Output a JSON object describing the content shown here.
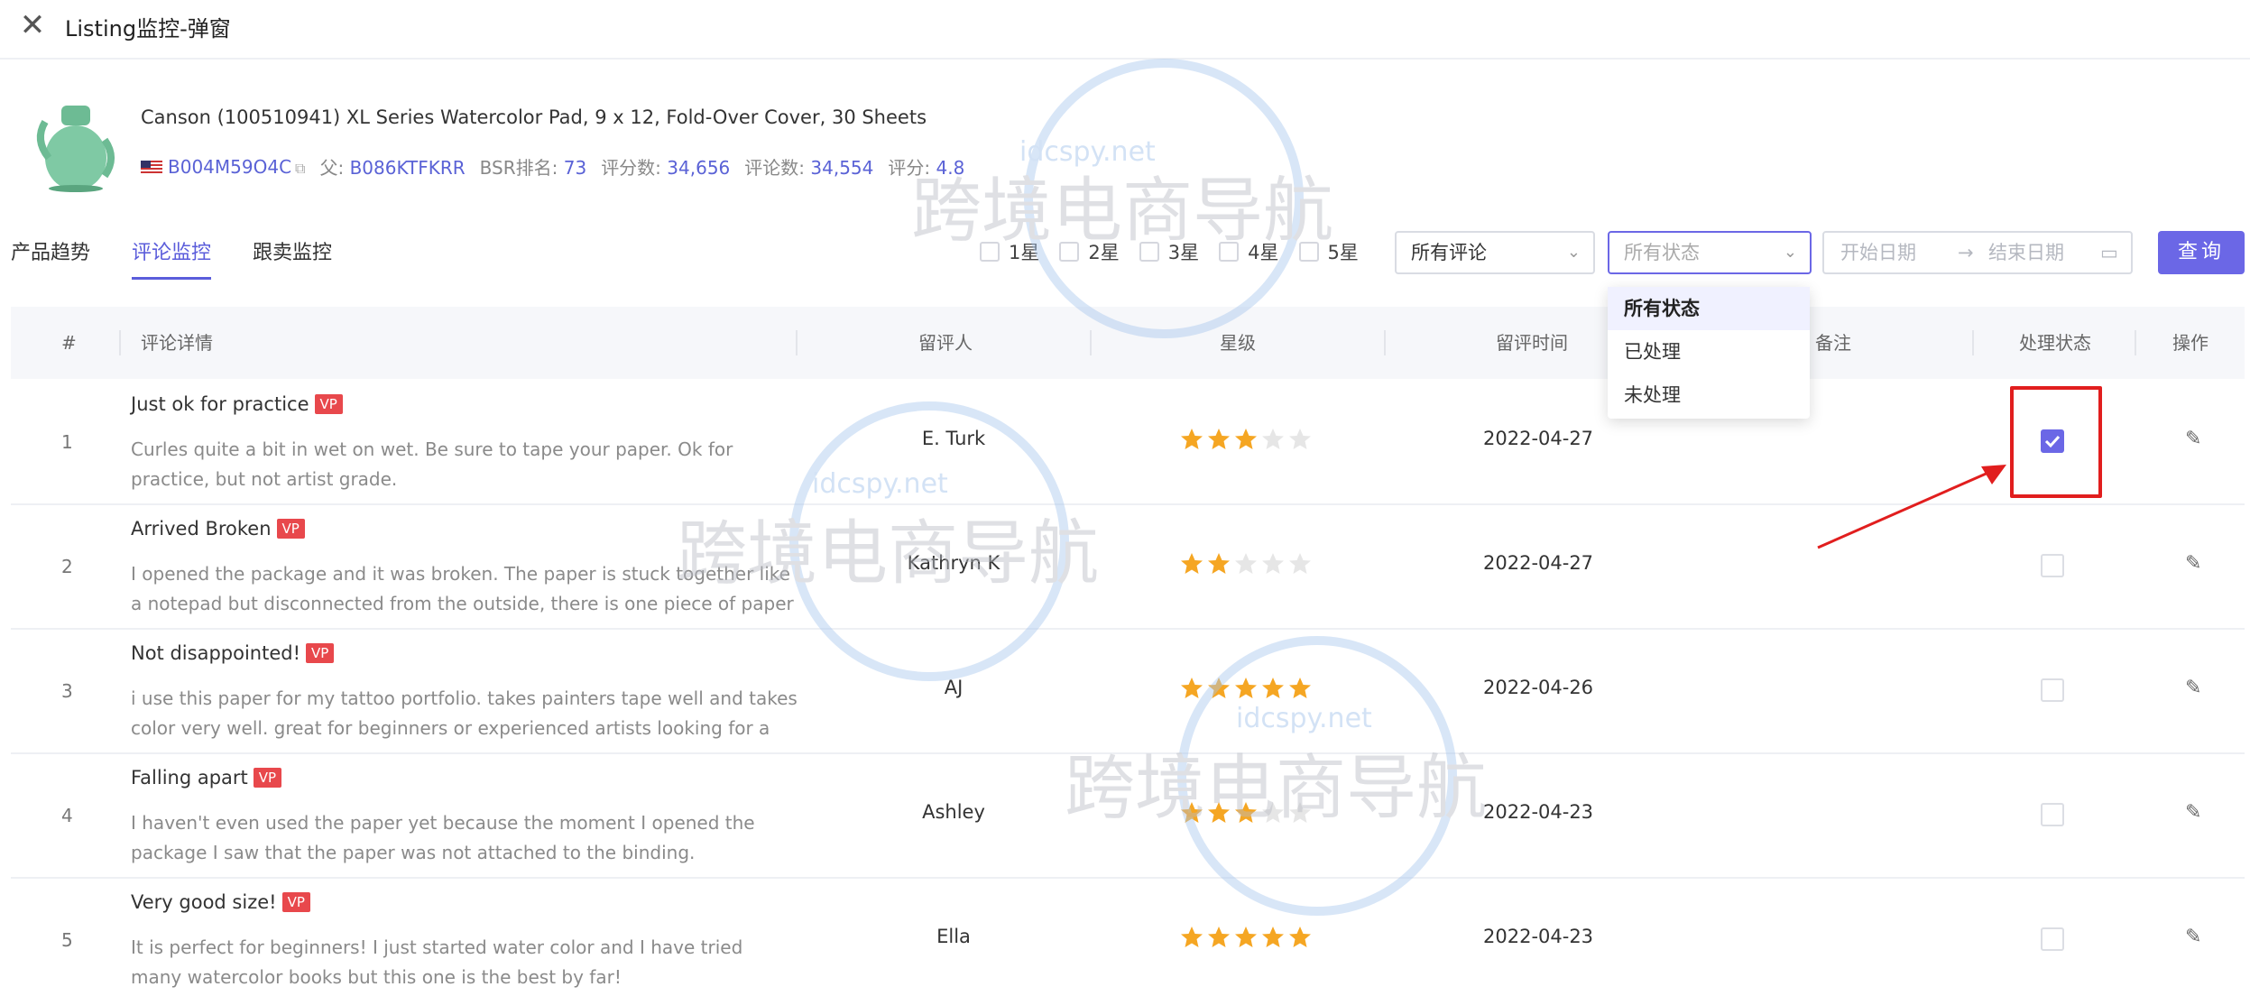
{
  "window": {
    "title": "Listing监控-弹窗"
  },
  "product": {
    "name": "Canson (100510941) XL Series Watercolor Pad, 9 x 12, Fold-Over Cover, 30 Sheets",
    "asin": "B004M59O4C",
    "parent_label": "父:",
    "parent_asin": "B086KTFKRR",
    "bsr_label": "BSR排名:",
    "bsr": "73",
    "ratings_label": "评分数:",
    "ratings": "34,656",
    "reviews_label": "评论数:",
    "reviews": "34,554",
    "score_label": "评分:",
    "score": "4.8"
  },
  "tabs": [
    {
      "label": "产品趋势",
      "active": false
    },
    {
      "label": "评论监控",
      "active": true
    },
    {
      "label": "跟卖监控",
      "active": false
    }
  ],
  "filters": {
    "star_options": [
      "1星",
      "2星",
      "3星",
      "4星",
      "5星"
    ],
    "review_select": "所有评论",
    "status_select_placeholder": "所有状态",
    "start_date_placeholder": "开始日期",
    "end_date_placeholder": "结束日期",
    "query_button": "查询"
  },
  "status_dropdown": {
    "options": [
      "所有状态",
      "已处理",
      "未处理"
    ],
    "selected": "所有状态"
  },
  "table": {
    "headers": {
      "index": "#",
      "details": "评论详情",
      "reviewer": "留评人",
      "rating": "星级",
      "time": "留评时间",
      "note": "备注",
      "status": "处理状态",
      "action": "操作"
    },
    "rows": [
      {
        "index": "1",
        "title": "Just ok for practice",
        "badge": "VP",
        "body": "Curles quite a bit in wet on wet. Be sure to tape your paper. Ok for practice, but not artist grade.",
        "reviewer": "E. Turk",
        "stars": 3,
        "date": "2022-04-27",
        "processed": true
      },
      {
        "index": "2",
        "title": "Arrived Broken",
        "badge": "VP",
        "body": "I opened the package and it was broken. The paper is stuck together like a notepad but disconnected from the outside, there is one piece of paper still...",
        "reviewer": "Kathryn K",
        "stars": 2,
        "date": "2022-04-27",
        "processed": false
      },
      {
        "index": "3",
        "title": "Not disappointed!",
        "badge": "VP",
        "body": "i use this paper for my tattoo portfolio. takes painters tape well and takes color very well. great for beginners or experienced artists looking for a deal.",
        "reviewer": "AJ",
        "stars": 5,
        "date": "2022-04-26",
        "processed": false
      },
      {
        "index": "4",
        "title": "Falling apart",
        "badge": "VP",
        "body": "I haven't even used the paper yet because the moment I opened the package I saw that the paper was not attached to the binding.",
        "reviewer": "Ashley",
        "stars": 3,
        "date": "2022-04-23",
        "processed": false
      },
      {
        "index": "5",
        "title": "Very good size!",
        "badge": "VP",
        "body": "It is perfect for beginners! I just started water color and I have tried many watercolor books but this one is the best by far!",
        "reviewer": "Ella",
        "stars": 5,
        "date": "2022-04-23",
        "processed": false
      }
    ]
  },
  "watermark": {
    "site": "idcspy.net",
    "text": "跨境电商导航"
  },
  "colors": {
    "accent": "#6b67e6",
    "star": "#f5a623",
    "star_empty": "#e6e6e6",
    "badge": "#e8484c",
    "highlight": "#e11e1e"
  }
}
